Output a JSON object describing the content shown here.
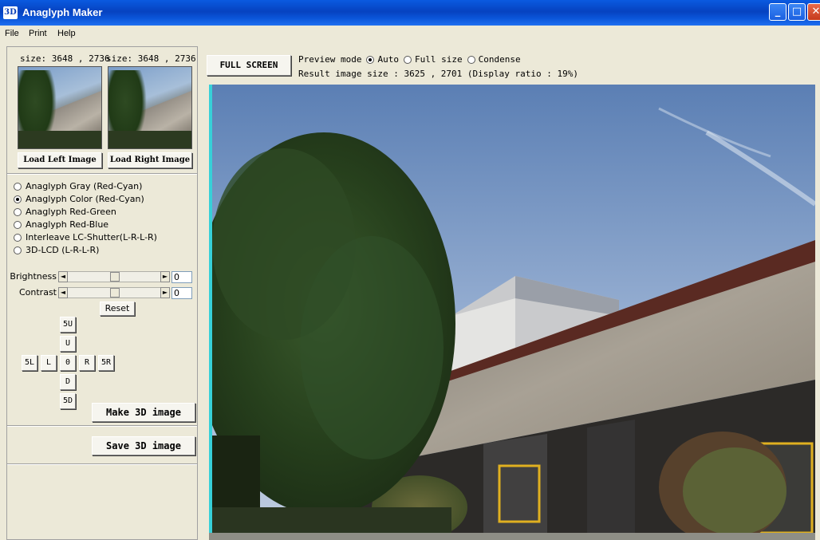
{
  "window": {
    "title": "Anaglyph Maker",
    "icon_text": "3D",
    "min_glyph": "_",
    "max_glyph": "□",
    "close_glyph": "✕"
  },
  "menu": {
    "items": [
      "File",
      "Print",
      "Help"
    ]
  },
  "left": {
    "size_left": "size: 3648 , 2736",
    "size_right": "size: 3648 , 2736",
    "load_left_label": "Load Left Image",
    "load_right_label": "Load Right Image",
    "modes": [
      {
        "label": "Anaglyph Gray (Red-Cyan)",
        "checked": false
      },
      {
        "label": "Anaglyph Color (Red-Cyan)",
        "checked": true
      },
      {
        "label": "Anaglyph Red-Green",
        "checked": false
      },
      {
        "label": "Anaglyph Red-Blue",
        "checked": false
      },
      {
        "label": "Interleave LC-Shutter(L-R-L-R)",
        "checked": false
      },
      {
        "label": "3D-LCD (L-R-L-R)",
        "checked": false
      }
    ],
    "brightness_label": "Brightness",
    "brightness_value": "0",
    "contrast_label": "Contrast",
    "contrast_value": "0",
    "reset_label": "Reset",
    "nav": {
      "up5": "5U",
      "up": "U",
      "left5": "5L",
      "left": "L",
      "center": "0",
      "right": "R",
      "right5": "5R",
      "down": "D",
      "down5": "5D"
    },
    "make_label": "Make 3D image",
    "save_label": "Save 3D image",
    "scroll_left_glyph": "◄",
    "scroll_right_glyph": "►"
  },
  "top": {
    "fullscreen_label": "FULL SCREEN",
    "preview_mode_label": "Preview mode",
    "preview_options": [
      {
        "label": "Auto",
        "checked": true
      },
      {
        "label": "Full size",
        "checked": false
      },
      {
        "label": "Condense",
        "checked": false
      }
    ],
    "result_text": "Result image size :  3625 , 2701  (Display ratio : 19%)"
  },
  "colors": {
    "titlebar": "#0a54d8",
    "cyan_edge": "#37d0d8",
    "green_band": "#2fc227"
  }
}
